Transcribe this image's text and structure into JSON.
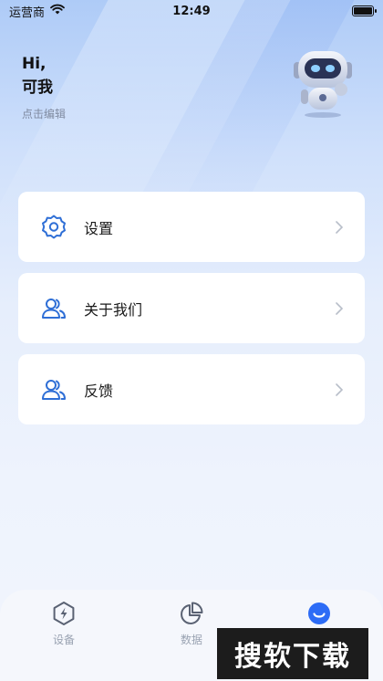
{
  "status_bar": {
    "carrier": "运营商",
    "time": "12:49",
    "wifi_icon": "wifi-icon",
    "battery_icon": "battery-icon"
  },
  "profile": {
    "greeting": "Hi,",
    "username": "可我",
    "edit_hint": "点击编辑",
    "avatar_icon": "robot-avatar"
  },
  "menu": {
    "items": [
      {
        "label": "设置",
        "icon": "settings-icon"
      },
      {
        "label": "关于我们",
        "icon": "users-icon"
      },
      {
        "label": "反馈",
        "icon": "users-icon"
      }
    ]
  },
  "tab_bar": {
    "tabs": [
      {
        "label": "设备",
        "icon": "device-bolt-icon",
        "active": false
      },
      {
        "label": "数据",
        "icon": "pie-chart-icon",
        "active": false
      },
      {
        "label": "",
        "icon": "smile-icon",
        "active": true
      }
    ]
  },
  "watermark": {
    "text": "搜软下载"
  },
  "colors": {
    "accent": "#2d6cf6",
    "icon_blue": "#2f6fd6",
    "card_bg": "#ffffff",
    "tab_inactive": "#9aa3b2"
  }
}
